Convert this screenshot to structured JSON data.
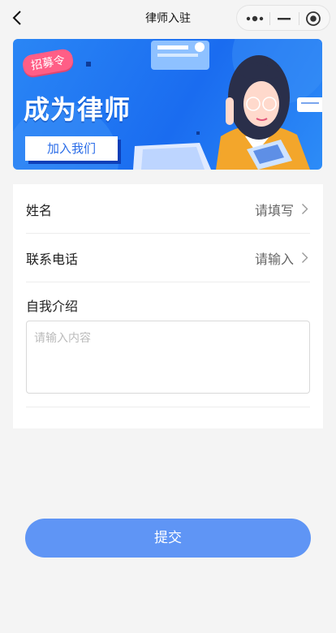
{
  "nav": {
    "title": "律师入驻"
  },
  "banner": {
    "badge": "招募令",
    "title": "成为律师",
    "button": "加入我们"
  },
  "form": {
    "name": {
      "label": "姓名",
      "value": "请填写"
    },
    "phone": {
      "label": "联系电话",
      "value": "请输入"
    },
    "intro": {
      "label": "自我介绍",
      "placeholder": "请输入内容"
    }
  },
  "submit_label": "提交",
  "colors": {
    "accent": "#5f95f5",
    "banner_blue": "#1a6cf0",
    "badge_pink": "#ff5e86"
  }
}
